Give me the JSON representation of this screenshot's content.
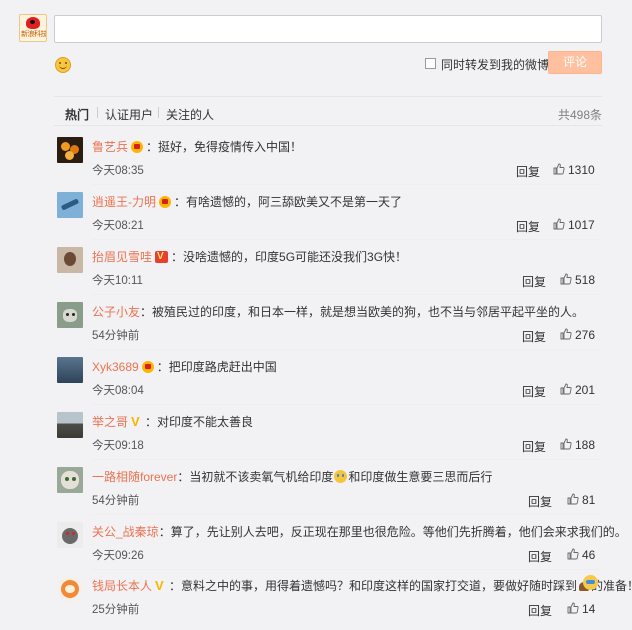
{
  "self_avatar": {
    "logo_text": "新浪科技"
  },
  "compose": {
    "placeholder": "",
    "emoji_icon": "smile-icon"
  },
  "repost": {
    "label": "同时转发到我的微博",
    "checked": false
  },
  "submit": {
    "label": "评论",
    "color": "#ffc09f"
  },
  "filter": {
    "tabs": [
      "热门",
      "认证用户",
      "关注的人"
    ],
    "active": "热门",
    "total": "共498条"
  },
  "accent": "#eb7350",
  "comments": [
    {
      "user": "鲁艺兵",
      "badge": "crown",
      "text": "：挺好，免得疫情传入中国！",
      "time": "今天08:35",
      "reply": "回复",
      "likes": "1310"
    },
    {
      "user": "逍遥王-力明",
      "badge": "crown",
      "text": "：有啥遗憾的，阿三舔欧美又不是第一天了",
      "time": "今天08:21",
      "reply": "回复",
      "likes": "1017"
    },
    {
      "user": "抬眉见雪哇",
      "badge": "vip",
      "text": "：没啥遗憾的，印度5G可能还没我们3G快！",
      "time": "今天10:11",
      "reply": "回复",
      "likes": "518"
    },
    {
      "user": "公子小友",
      "badge": "",
      "text": "：被殖民过的印度，和日本一样，就是想当欧美的狗，也不当与邻居平起平坐的人。",
      "time": "54分钟前",
      "reply": "回复",
      "likes": "276"
    },
    {
      "user": "Xyk3689",
      "badge": "crown",
      "text": "：把印度路虎赶出中国",
      "time": "今天08:04",
      "reply": "回复",
      "likes": "201"
    },
    {
      "user": "举之哥",
      "badge": "vgold",
      "text": "：对印度不能太善良",
      "time": "今天09:18",
      "reply": "回复",
      "likes": "188"
    },
    {
      "user": "一路相随forever",
      "badge": "",
      "text_a": "：当初就不该卖氧气机给印度",
      "text_b": "和印度做生意要三思而后行",
      "time": "54分钟前",
      "reply": "回复",
      "likes": "81"
    },
    {
      "user": "关公_战秦琼",
      "badge": "",
      "text": "：算了，先让别人去吧，反正现在那里也很危险。等他们先折腾着，他们会来求我们的。",
      "time": "今天09:26",
      "reply": "回复",
      "likes": "46"
    },
    {
      "user": "钱局长本人",
      "badge": "vgold",
      "text_a": "：意料之中的事，用得着遗憾吗？和印度这样的国家打交道，要做好随时踩到",
      "text_b": "的准备！",
      "time": "25分钟前",
      "reply": "回复",
      "likes": "14"
    }
  ]
}
